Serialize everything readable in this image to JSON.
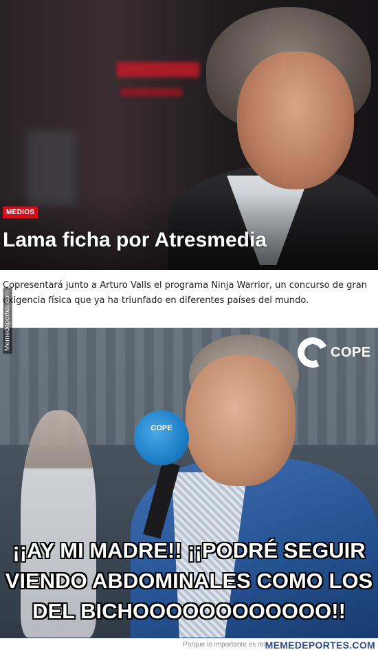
{
  "news": {
    "category": "MEDIOS",
    "headline": "Lama ficha por Atresmedia",
    "summary": "Copresentará junto a Arturo Valls el programa Ninja Warrior, un concurso de gran exigencia física que ya ha triunfado en diferentes países del mundo."
  },
  "radio": {
    "logo_text": "COPE",
    "mic_logo_text": "COPE",
    "caption": "¡¡AY MI MADRE!! ¡¡PODRÉ SEGUIR VIENDO ABDOMINALES COMO LOS DEL BICHOOOOOOOOOOOO!!"
  },
  "watermark": {
    "side_text": "Memedeportes.com"
  },
  "footer": {
    "tagline": "Porque lo importante es reír",
    "brand": "MEMEDEPORTES.COM"
  },
  "colors": {
    "badge": "#d0101c",
    "jacket": "#24508f",
    "microphone": "#1f7fc7",
    "brand": "#2a4f8a"
  }
}
